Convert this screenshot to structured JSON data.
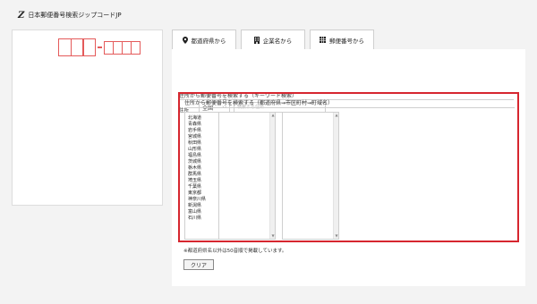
{
  "header": {
    "logo": "Z",
    "title": "日本郵便番号検索ジップコードJP"
  },
  "tabs": [
    {
      "label": "都道府県から",
      "icon": "location-pin-icon"
    },
    {
      "label": "企業名から",
      "icon": "building-icon"
    },
    {
      "label": "郵便番号から",
      "icon": "grid-icon"
    }
  ],
  "keyword_section": {
    "title": "住所から郵便番号を検索する（キーワード検索）",
    "pref_label": "住所",
    "pref_select_value": "全国",
    "search_placeholder": "検索する住所"
  },
  "hierarchy_section": {
    "title": "住所から郵便番号を検索する（都道府県→市区町村→町域名）",
    "prefectures": [
      "北海道",
      "青森県",
      "岩手県",
      "宮城県",
      "秋田県",
      "山形県",
      "福島県",
      "茨城県",
      "栃木県",
      "群馬県",
      "埼玉県",
      "千葉県",
      "東京都",
      "神奈川県",
      "新潟県",
      "富山県",
      "石川県"
    ]
  },
  "note": "※都道府県名以外は50音順で掲載しています。",
  "clear_label": "クリア",
  "colors": {
    "accent_red": "#d6262f",
    "postcard_red": "#e45a5a"
  }
}
